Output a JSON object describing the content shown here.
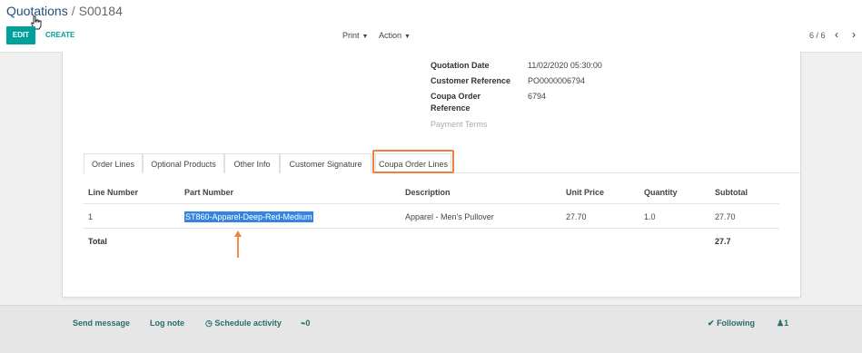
{
  "breadcrumb": {
    "parent": "Quotations",
    "separator": "/",
    "current": "S00184"
  },
  "toolbar": {
    "edit_label": "EDIT",
    "create_label": "CREATE",
    "print_label": "Print",
    "action_label": "Action",
    "pager": "6 / 6"
  },
  "fields": {
    "quotation_date_label": "Quotation Date",
    "quotation_date_value": "11/02/2020 05:30:00",
    "customer_ref_label": "Customer Reference",
    "customer_ref_value": "PO0000006794",
    "coupa_ref_label_1": "Coupa Order",
    "coupa_ref_label_2": "Reference",
    "coupa_ref_value": "6794",
    "payment_terms_label": "Payment Terms"
  },
  "tabs": [
    {
      "label": "Order Lines"
    },
    {
      "label": "Optional Products"
    },
    {
      "label": "Other Info"
    },
    {
      "label": "Customer Signature"
    },
    {
      "label": "Coupa Order Lines"
    }
  ],
  "table": {
    "headers": [
      "Line Number",
      "Part Number",
      "Description",
      "Unit Price",
      "Quantity",
      "Subtotal"
    ],
    "rows": [
      [
        "1",
        "ST860-Apparel-Deep-Red-Medium",
        "Apparel - Men's Pullover",
        "27.70",
        "1.0",
        "27.70"
      ]
    ],
    "footer_label": "Total",
    "footer_value": "27.7"
  },
  "chatter": {
    "send_message": "Send message",
    "log_note": "Log note",
    "schedule_activity": "Schedule activity",
    "attachments": "0",
    "following": "Following",
    "followers": "1"
  },
  "colors": {
    "accent": "#00a09d",
    "highlight": "#f0803c",
    "selection": "#3584e4"
  }
}
